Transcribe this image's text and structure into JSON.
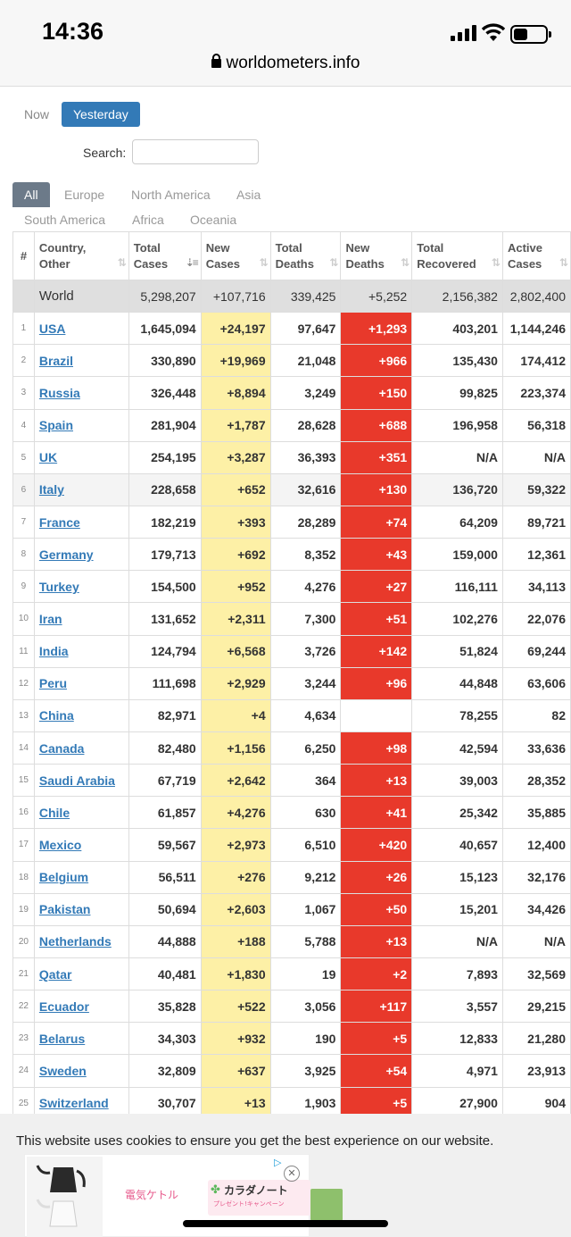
{
  "status_bar": {
    "time": "14:36",
    "battery_level": 0.45
  },
  "browser": {
    "url": "worldometers.info"
  },
  "day_toggle": {
    "now": "Now",
    "yesterday": "Yesterday",
    "selected": "Yesterday"
  },
  "search": {
    "label": "Search:",
    "value": ""
  },
  "region_tabs": [
    "All",
    "Europe",
    "North America",
    "Asia",
    "South America",
    "Africa",
    "Oceania"
  ],
  "region_selected": "All",
  "table": {
    "headers": [
      "#",
      "Country,\nOther",
      "Total\nCases",
      "New\nCases",
      "Total\nDeaths",
      "New\nDeaths",
      "Total\nRecovered",
      "Active\nCases"
    ],
    "world": {
      "country": "World",
      "total_cases": "5,298,207",
      "new_cases": "+107,716",
      "total_deaths": "339,425",
      "new_deaths": "+5,252",
      "total_recovered": "2,156,382",
      "active_cases": "2,802,400"
    },
    "rows": [
      [
        "1",
        "USA",
        "1,645,094",
        "+24,197",
        "97,647",
        "+1,293",
        "403,201",
        "1,144,246"
      ],
      [
        "2",
        "Brazil",
        "330,890",
        "+19,969",
        "21,048",
        "+966",
        "135,430",
        "174,412"
      ],
      [
        "3",
        "Russia",
        "326,448",
        "+8,894",
        "3,249",
        "+150",
        "99,825",
        "223,374"
      ],
      [
        "4",
        "Spain",
        "281,904",
        "+1,787",
        "28,628",
        "+688",
        "196,958",
        "56,318"
      ],
      [
        "5",
        "UK",
        "254,195",
        "+3,287",
        "36,393",
        "+351",
        "N/A",
        "N/A"
      ],
      [
        "6",
        "Italy",
        "228,658",
        "+652",
        "32,616",
        "+130",
        "136,720",
        "59,322"
      ],
      [
        "7",
        "France",
        "182,219",
        "+393",
        "28,289",
        "+74",
        "64,209",
        "89,721"
      ],
      [
        "8",
        "Germany",
        "179,713",
        "+692",
        "8,352",
        "+43",
        "159,000",
        "12,361"
      ],
      [
        "9",
        "Turkey",
        "154,500",
        "+952",
        "4,276",
        "+27",
        "116,111",
        "34,113"
      ],
      [
        "10",
        "Iran",
        "131,652",
        "+2,311",
        "7,300",
        "+51",
        "102,276",
        "22,076"
      ],
      [
        "11",
        "India",
        "124,794",
        "+6,568",
        "3,726",
        "+142",
        "51,824",
        "69,244"
      ],
      [
        "12",
        "Peru",
        "111,698",
        "+2,929",
        "3,244",
        "+96",
        "44,848",
        "63,606"
      ],
      [
        "13",
        "China",
        "82,971",
        "+4",
        "4,634",
        "",
        "78,255",
        "82"
      ],
      [
        "14",
        "Canada",
        "82,480",
        "+1,156",
        "6,250",
        "+98",
        "42,594",
        "33,636"
      ],
      [
        "15",
        "Saudi Arabia",
        "67,719",
        "+2,642",
        "364",
        "+13",
        "39,003",
        "28,352"
      ],
      [
        "16",
        "Chile",
        "61,857",
        "+4,276",
        "630",
        "+41",
        "25,342",
        "35,885"
      ],
      [
        "17",
        "Mexico",
        "59,567",
        "+2,973",
        "6,510",
        "+420",
        "40,657",
        "12,400"
      ],
      [
        "18",
        "Belgium",
        "56,511",
        "+276",
        "9,212",
        "+26",
        "15,123",
        "32,176"
      ],
      [
        "19",
        "Pakistan",
        "50,694",
        "+2,603",
        "1,067",
        "+50",
        "15,201",
        "34,426"
      ],
      [
        "20",
        "Netherlands",
        "44,888",
        "+188",
        "5,788",
        "+13",
        "N/A",
        "N/A"
      ],
      [
        "21",
        "Qatar",
        "40,481",
        "+1,830",
        "19",
        "+2",
        "7,893",
        "32,569"
      ],
      [
        "22",
        "Ecuador",
        "35,828",
        "+522",
        "3,056",
        "+117",
        "3,557",
        "29,215"
      ],
      [
        "23",
        "Belarus",
        "34,303",
        "+932",
        "190",
        "+5",
        "12,833",
        "21,280"
      ],
      [
        "24",
        "Sweden",
        "32,809",
        "+637",
        "3,925",
        "+54",
        "4,971",
        "23,913"
      ],
      [
        "25",
        "Switzerland",
        "30,707",
        "+13",
        "1,903",
        "+5",
        "27,900",
        "904"
      ]
    ]
  },
  "cookie_banner": {
    "text": "This website uses cookies to ensure you get the best experience on our website."
  },
  "ad": {
    "text1": "電気ケトル",
    "text2": "カラダノート",
    "text3": "プレゼント!キャンペーン"
  },
  "colors": {
    "accent": "#337ab7",
    "new_cases_bg": "#fdf0a6",
    "new_deaths_bg": "#e8392b"
  }
}
